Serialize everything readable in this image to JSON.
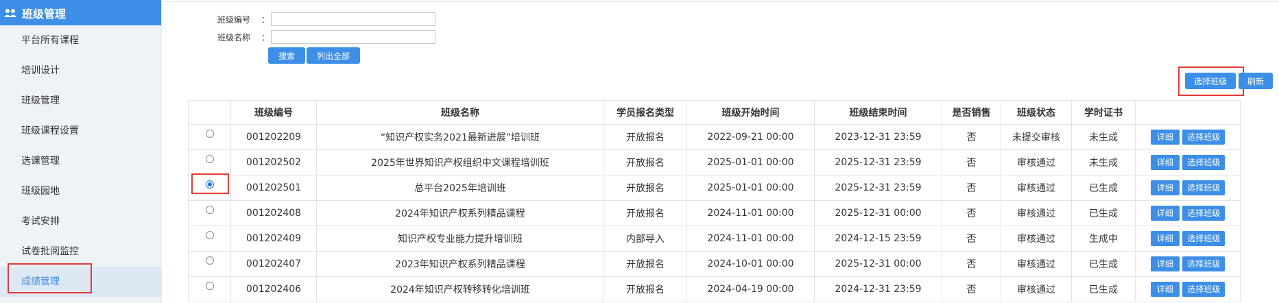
{
  "sidebar": {
    "header": "班级管理",
    "items": [
      "平台所有课程",
      "培训设计",
      "班级管理",
      "班级课程设置",
      "选课管理",
      "班级园地",
      "考试安排",
      "试卷批阅监控",
      "成绩管理"
    ],
    "active_index": 8
  },
  "search": {
    "class_no_label": "班级编号",
    "class_name_label": "班级名称",
    "colon": "：",
    "class_no_value": "",
    "class_name_value": "",
    "search_button": "搜索",
    "list_all_button": "列出全部"
  },
  "toolbar": {
    "select_class_button": "选择班级",
    "refresh_button": "刷新"
  },
  "table": {
    "headers": [
      "",
      "班级编号",
      "班级名称",
      "学员报名类型",
      "班级开始时间",
      "班级结束时间",
      "是否销售",
      "班级状态",
      "学时证书",
      ""
    ],
    "detail_label": "详细",
    "select_label": "选择班级",
    "rows": [
      {
        "no": "001202209",
        "name": "“知识产权实务2021最新进展”培训班",
        "reg": "开放报名",
        "start": "2022-09-21 00:00",
        "end": "2023-12-31 23:59",
        "sale": "否",
        "status": "未提交审核",
        "cert": "未生成",
        "selected": false
      },
      {
        "no": "001202502",
        "name": "2025年世界知识产权组织中文课程培训班",
        "reg": "开放报名",
        "start": "2025-01-01 00:00",
        "end": "2025-12-31 23:59",
        "sale": "否",
        "status": "审核通过",
        "cert": "未生成",
        "selected": false
      },
      {
        "no": "001202501",
        "name": "总平台2025年培训班",
        "reg": "开放报名",
        "start": "2025-01-01 00:00",
        "end": "2025-12-31 23:59",
        "sale": "否",
        "status": "审核通过",
        "cert": "已生成",
        "selected": true
      },
      {
        "no": "001202408",
        "name": "2024年知识产权系列精品课程",
        "reg": "开放报名",
        "start": "2024-11-01 00:00",
        "end": "2025-12-31 00:00",
        "sale": "否",
        "status": "审核通过",
        "cert": "已生成",
        "selected": false
      },
      {
        "no": "001202409",
        "name": "知识产权专业能力提升培训班",
        "reg": "内部导入",
        "start": "2024-11-01 00:00",
        "end": "2024-12-15 23:59",
        "sale": "否",
        "status": "审核通过",
        "cert": "生成中",
        "selected": false
      },
      {
        "no": "001202407",
        "name": "2023年知识产权系列精品课程",
        "reg": "开放报名",
        "start": "2024-10-01 00:00",
        "end": "2025-12-31 00:00",
        "sale": "否",
        "status": "审核通过",
        "cert": "已生成",
        "selected": false
      },
      {
        "no": "001202406",
        "name": "2024年知识产权转移转化培训班",
        "reg": "开放报名",
        "start": "2024-04-19 00:00",
        "end": "2024-12-31 23:59",
        "sale": "否",
        "status": "审核通过",
        "cert": "已生成",
        "selected": false
      }
    ]
  },
  "colors": {
    "accent": "#3c8ee6",
    "highlight": "#e53935",
    "sidebar_bg": "#eef3f8"
  }
}
